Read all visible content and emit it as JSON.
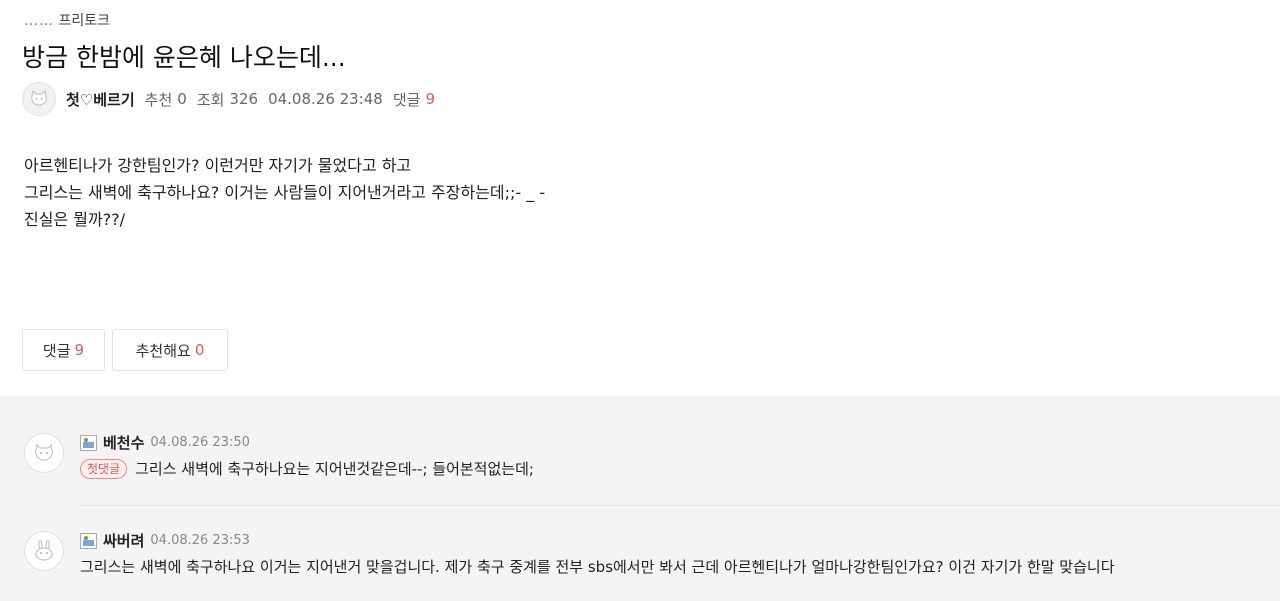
{
  "breadcrumb": {
    "prefix": "……",
    "board": "프리토크"
  },
  "post": {
    "title": "방금 한밤에 윤은혜 나오는데...",
    "author": "첫♡베르기",
    "recommend_label": "추천",
    "recommend_count": "0",
    "views_label": "조회",
    "views_count": "326",
    "datetime": "04.08.26 23:48",
    "comments_label": "댓글",
    "comments_count": "9",
    "body_lines": [
      "아르헨티나가 강한팀인가? 이런거만 자기가 물었다고 하고",
      "그리스는 새벽에 축구하나요? 이거는 사람들이 지어낸거라고 주장하는데;;- _ -",
      "진실은 뭘까??/"
    ]
  },
  "buttons": {
    "comments_label": "댓글",
    "comments_count": "9",
    "recommend_label": "추천해요",
    "recommend_count": "0"
  },
  "comments": [
    {
      "name": "베천수",
      "datetime": "04.08.26 23:50",
      "badge": "첫댓글",
      "text": "그리스 새벽에 축구하나요는 지어낸것같은데--; 들어본적없는데;"
    },
    {
      "name": "싸버려",
      "datetime": "04.08.26 23:53",
      "text": "그리스는 새벽에 축구하나요 이거는 지어낸거 맞을겁니다. 제가 축구 중계를 전부 sbs에서만 봐서 근데 아르헨티나가 얼마나강한팀인가요? 이건 자기가 한말 맞습니다"
    }
  ],
  "icons": {
    "author_avatar": "cat-avatar-icon",
    "commenter1_avatar": "cat-avatar-icon",
    "commenter2_avatar": "bunny-avatar-icon",
    "member_icon": "broken-image-icon"
  },
  "colors": {
    "accent": "#e8584a",
    "comment_bg": "#f4f4f4"
  }
}
